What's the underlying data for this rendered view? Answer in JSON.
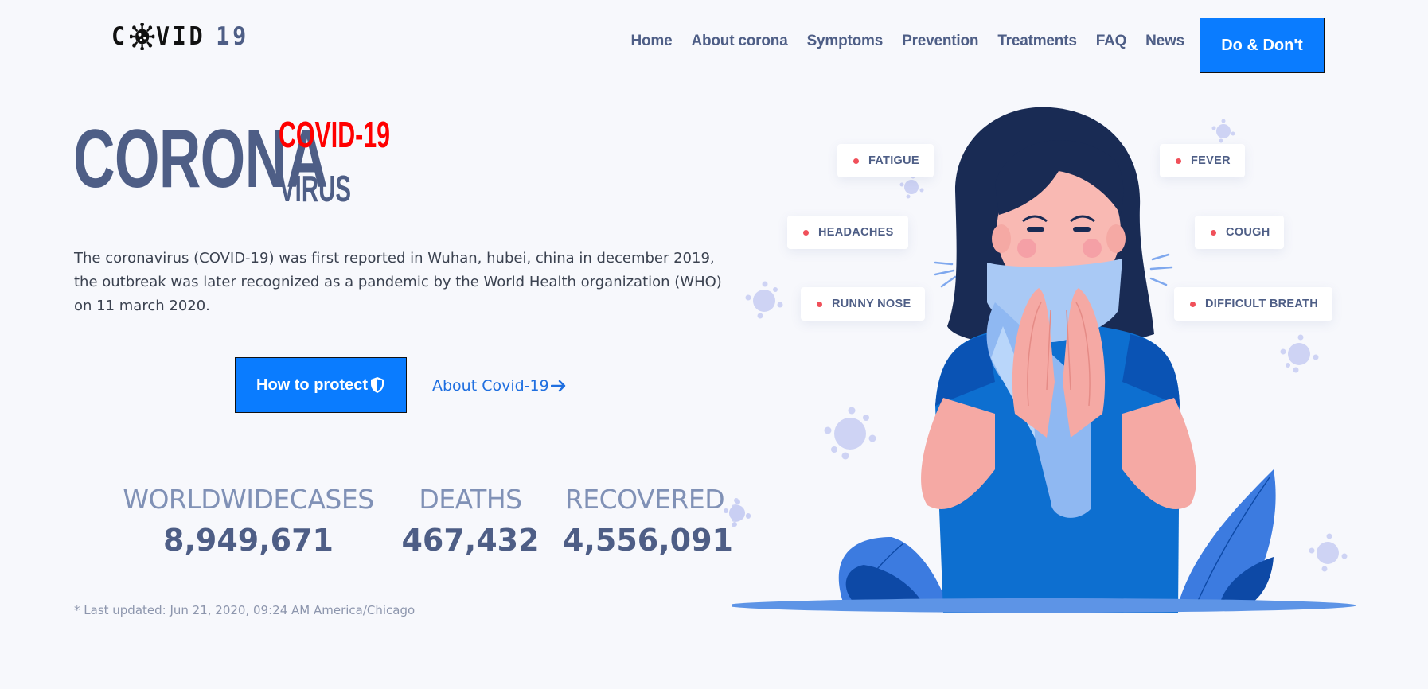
{
  "header": {
    "logo": {
      "prefix": "C",
      "suffix": "VID",
      "number": "19"
    },
    "nav": [
      "Home",
      "About corona",
      "Symptoms",
      "Prevention",
      "Treatments",
      "FAQ",
      "News"
    ],
    "cta_label": "Do & Don't"
  },
  "hero": {
    "title_main": "CORONA",
    "title_top": "COVID-19",
    "title_bottom": "VIRUS",
    "description": "The coronavirus (COVID-19) was first reported in Wuhan, hubei, china in december 2019, the outbreak was later recognized as a pandemic by the World Health organization (WHO) on 11 march 2020.",
    "primary_button": "How to protect",
    "secondary_link": "About Covid-19"
  },
  "stats": [
    {
      "label": "WORLDWIDECASES",
      "value": "8,949,671"
    },
    {
      "label": "DEATHS",
      "value": "467,432"
    },
    {
      "label": "RECOVERED",
      "value": "4,556,091"
    }
  ],
  "last_updated": "* Last updated: Jun 21, 2020, 09:24 AM America/Chicago",
  "symptoms": [
    "FATIGUE",
    "FEVER",
    "HEADACHES",
    "COUGH",
    "RUNNY NOSE",
    "DIFFICULT BREATH"
  ],
  "icons": {
    "protect": "shield-icon",
    "about": "arrow-right-icon",
    "logo_virus": "virus-icon"
  },
  "colors": {
    "accent": "#0a7cff",
    "title_red": "#ff0000",
    "text_slate": "#4e5e86",
    "symptom_dot": "#f0505a",
    "background": "#f7f8fc"
  }
}
